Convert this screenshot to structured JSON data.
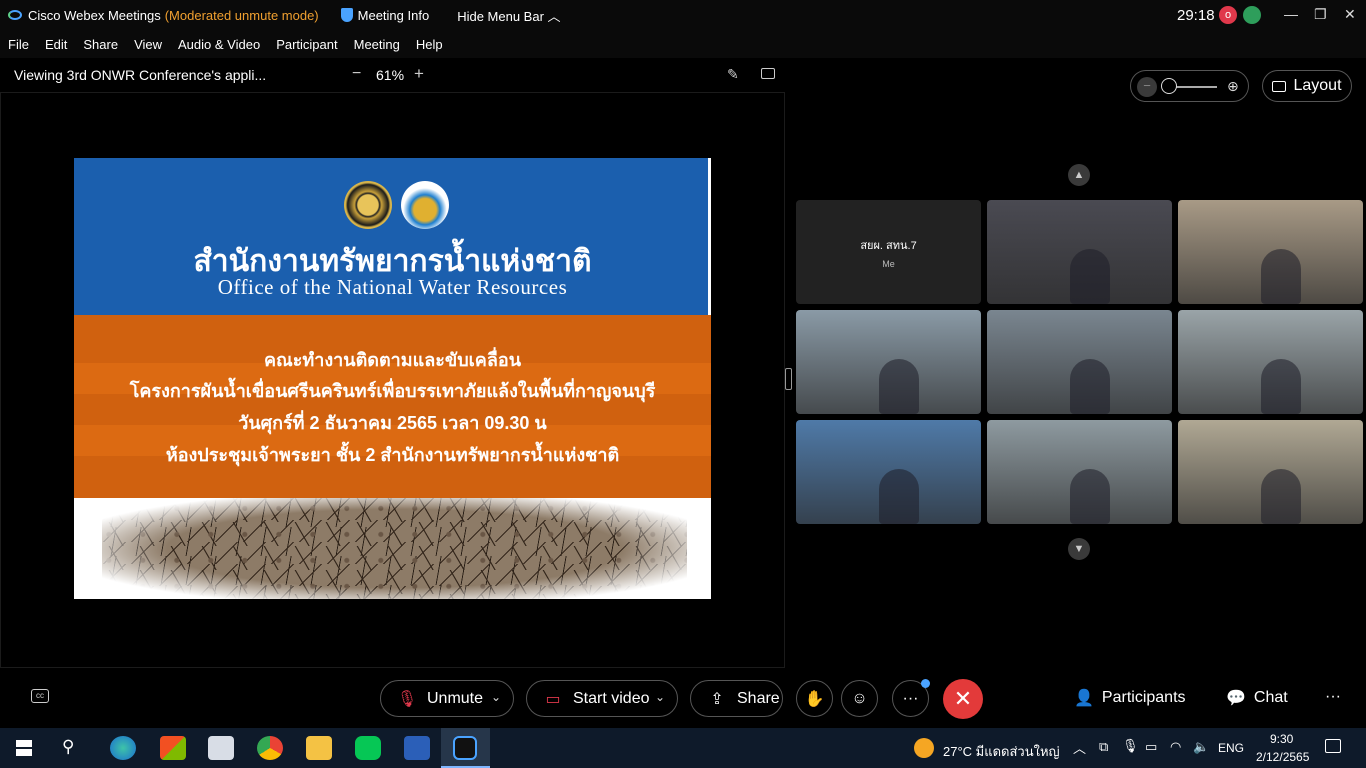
{
  "titlebar": {
    "app": "Cisco Webex Meetings",
    "mode": "(Moderated unmute mode)",
    "meeting_info": "Meeting Info",
    "hide_menu": "Hide Menu Bar",
    "timer": "29:18",
    "rec_label": "o"
  },
  "menu": [
    "File",
    "Edit",
    "Share",
    "View",
    "Audio & Video",
    "Participant",
    "Meeting",
    "Help"
  ],
  "share": {
    "title": "Viewing 3rd ONWR Conference's appli...",
    "zoom": "61%",
    "zoom_minus": "−",
    "zoom_plus": "+"
  },
  "slide": {
    "th_title": "สำนักงานทรัพยากรน้ำแห่งชาติ",
    "en_title": "Office of the National Water Resources",
    "lines": [
      "คณะทำงานติดตามและขับเคลื่อน",
      "โครงการผันน้ำเขื่อนศรีนครินทร์เพื่อบรรเทาภัยแล้งในพื้นที่กาญจนบุรี",
      "วันศุกร์ที่ 2 ธันวาคม 2565 เวลา 09.30 น",
      "ห้องประชุมเจ้าพระยา ชั้น 2 สำนักงานทรัพยากรน้ำแห่งชาติ"
    ]
  },
  "video": {
    "layout_label": "Layout",
    "zoom_minus": "−",
    "zoom_plus": "⊕",
    "self_name": "สยผ. สทน.7",
    "self_sub": "Me",
    "tiles": [
      {
        "kind": "conference-room",
        "color": "#4a4a52"
      },
      {
        "kind": "person-masked",
        "color": "#a89a86"
      },
      {
        "kind": "meeting-room-logo",
        "color": "#8a9aa6"
      },
      {
        "kind": "person-desk",
        "color": "#7a8690"
      },
      {
        "kind": "person-masked",
        "color": "#9aa4a8"
      },
      {
        "kind": "computer-room",
        "color": "#4f7aa8"
      },
      {
        "kind": "person-office",
        "color": "#8e9aa0"
      },
      {
        "kind": "person-shelves",
        "color": "#b0a894"
      }
    ]
  },
  "controls": {
    "unmute": "Unmute",
    "start_video": "Start video",
    "share": "Share",
    "participants": "Participants",
    "chat": "Chat",
    "more": "···"
  },
  "taskbar": {
    "weather": "27°C  มีแดดส่วนใหญ่",
    "lang": "ENG",
    "time": "9:30",
    "date": "2/12/2565"
  }
}
